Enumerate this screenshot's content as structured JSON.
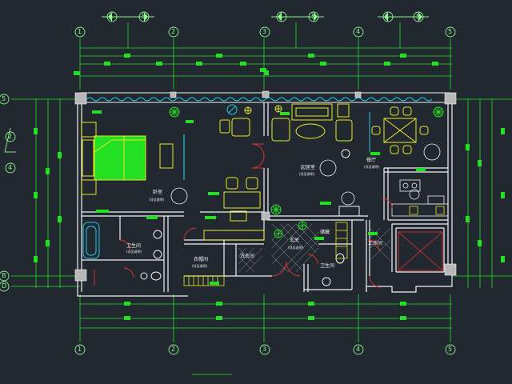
{
  "axes": {
    "columns": [
      "1",
      "2",
      "3",
      "4",
      "5"
    ],
    "rows": [
      "5",
      "2",
      "4",
      "B",
      "D"
    ],
    "grouped_pairs": [
      [
        "1",
        "5"
      ],
      [
        "1",
        "5"
      ],
      [
        "1",
        "5"
      ]
    ]
  },
  "rooms": {
    "bedroom": {
      "name": "卧室",
      "note": "(详见说明)"
    },
    "living": {
      "name": "起居室",
      "note": "(详见说明)"
    },
    "dining": {
      "name": "餐厅",
      "note": "(详见说明)"
    },
    "cloak": {
      "name": "衣帽间",
      "note": "(详见说明)"
    },
    "bath": {
      "name": "卫生间",
      "note": "(详见说明)"
    },
    "laundry": {
      "name": "洗衣间"
    },
    "entry": {
      "name": "玄关",
      "note": "(详见说明)"
    },
    "storage": {
      "name": "储藏"
    },
    "wc": {
      "name": "卫生间"
    },
    "service": {
      "name": "工作间"
    }
  },
  "colors": {
    "background": "#212830",
    "wall": "#f2f2f2",
    "dimension": "#22e022",
    "furniture": "#e8e820",
    "plant": "#22e022",
    "water": "#22c8e8",
    "door": "#e83030",
    "axis_bubble": "#8ef58e"
  }
}
